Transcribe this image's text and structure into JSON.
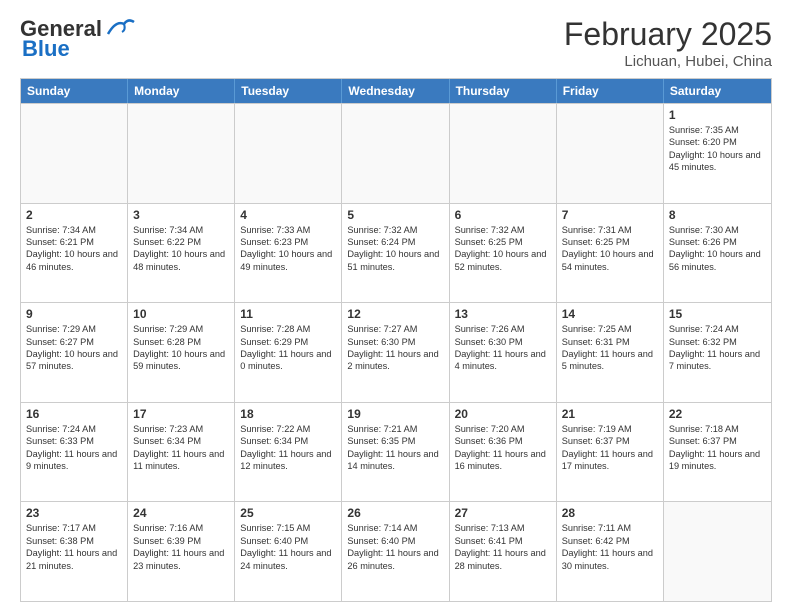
{
  "header": {
    "logo_general": "General",
    "logo_blue": "Blue",
    "month_year": "February 2025",
    "location": "Lichuan, Hubei, China"
  },
  "day_headers": [
    "Sunday",
    "Monday",
    "Tuesday",
    "Wednesday",
    "Thursday",
    "Friday",
    "Saturday"
  ],
  "weeks": [
    {
      "cells": [
        {
          "day": "",
          "info": "",
          "empty": true
        },
        {
          "day": "",
          "info": "",
          "empty": true
        },
        {
          "day": "",
          "info": "",
          "empty": true
        },
        {
          "day": "",
          "info": "",
          "empty": true
        },
        {
          "day": "",
          "info": "",
          "empty": true
        },
        {
          "day": "",
          "info": "",
          "empty": true
        },
        {
          "day": "1",
          "info": "Sunrise: 7:35 AM\nSunset: 6:20 PM\nDaylight: 10 hours and 45 minutes.",
          "empty": false
        }
      ]
    },
    {
      "cells": [
        {
          "day": "2",
          "info": "Sunrise: 7:34 AM\nSunset: 6:21 PM\nDaylight: 10 hours and 46 minutes.",
          "empty": false
        },
        {
          "day": "3",
          "info": "Sunrise: 7:34 AM\nSunset: 6:22 PM\nDaylight: 10 hours and 48 minutes.",
          "empty": false
        },
        {
          "day": "4",
          "info": "Sunrise: 7:33 AM\nSunset: 6:23 PM\nDaylight: 10 hours and 49 minutes.",
          "empty": false
        },
        {
          "day": "5",
          "info": "Sunrise: 7:32 AM\nSunset: 6:24 PM\nDaylight: 10 hours and 51 minutes.",
          "empty": false
        },
        {
          "day": "6",
          "info": "Sunrise: 7:32 AM\nSunset: 6:25 PM\nDaylight: 10 hours and 52 minutes.",
          "empty": false
        },
        {
          "day": "7",
          "info": "Sunrise: 7:31 AM\nSunset: 6:25 PM\nDaylight: 10 hours and 54 minutes.",
          "empty": false
        },
        {
          "day": "8",
          "info": "Sunrise: 7:30 AM\nSunset: 6:26 PM\nDaylight: 10 hours and 56 minutes.",
          "empty": false
        }
      ]
    },
    {
      "cells": [
        {
          "day": "9",
          "info": "Sunrise: 7:29 AM\nSunset: 6:27 PM\nDaylight: 10 hours and 57 minutes.",
          "empty": false
        },
        {
          "day": "10",
          "info": "Sunrise: 7:29 AM\nSunset: 6:28 PM\nDaylight: 10 hours and 59 minutes.",
          "empty": false
        },
        {
          "day": "11",
          "info": "Sunrise: 7:28 AM\nSunset: 6:29 PM\nDaylight: 11 hours and 0 minutes.",
          "empty": false
        },
        {
          "day": "12",
          "info": "Sunrise: 7:27 AM\nSunset: 6:30 PM\nDaylight: 11 hours and 2 minutes.",
          "empty": false
        },
        {
          "day": "13",
          "info": "Sunrise: 7:26 AM\nSunset: 6:30 PM\nDaylight: 11 hours and 4 minutes.",
          "empty": false
        },
        {
          "day": "14",
          "info": "Sunrise: 7:25 AM\nSunset: 6:31 PM\nDaylight: 11 hours and 5 minutes.",
          "empty": false
        },
        {
          "day": "15",
          "info": "Sunrise: 7:24 AM\nSunset: 6:32 PM\nDaylight: 11 hours and 7 minutes.",
          "empty": false
        }
      ]
    },
    {
      "cells": [
        {
          "day": "16",
          "info": "Sunrise: 7:24 AM\nSunset: 6:33 PM\nDaylight: 11 hours and 9 minutes.",
          "empty": false
        },
        {
          "day": "17",
          "info": "Sunrise: 7:23 AM\nSunset: 6:34 PM\nDaylight: 11 hours and 11 minutes.",
          "empty": false
        },
        {
          "day": "18",
          "info": "Sunrise: 7:22 AM\nSunset: 6:34 PM\nDaylight: 11 hours and 12 minutes.",
          "empty": false
        },
        {
          "day": "19",
          "info": "Sunrise: 7:21 AM\nSunset: 6:35 PM\nDaylight: 11 hours and 14 minutes.",
          "empty": false
        },
        {
          "day": "20",
          "info": "Sunrise: 7:20 AM\nSunset: 6:36 PM\nDaylight: 11 hours and 16 minutes.",
          "empty": false
        },
        {
          "day": "21",
          "info": "Sunrise: 7:19 AM\nSunset: 6:37 PM\nDaylight: 11 hours and 17 minutes.",
          "empty": false
        },
        {
          "day": "22",
          "info": "Sunrise: 7:18 AM\nSunset: 6:37 PM\nDaylight: 11 hours and 19 minutes.",
          "empty": false
        }
      ]
    },
    {
      "cells": [
        {
          "day": "23",
          "info": "Sunrise: 7:17 AM\nSunset: 6:38 PM\nDaylight: 11 hours and 21 minutes.",
          "empty": false
        },
        {
          "day": "24",
          "info": "Sunrise: 7:16 AM\nSunset: 6:39 PM\nDaylight: 11 hours and 23 minutes.",
          "empty": false
        },
        {
          "day": "25",
          "info": "Sunrise: 7:15 AM\nSunset: 6:40 PM\nDaylight: 11 hours and 24 minutes.",
          "empty": false
        },
        {
          "day": "26",
          "info": "Sunrise: 7:14 AM\nSunset: 6:40 PM\nDaylight: 11 hours and 26 minutes.",
          "empty": false
        },
        {
          "day": "27",
          "info": "Sunrise: 7:13 AM\nSunset: 6:41 PM\nDaylight: 11 hours and 28 minutes.",
          "empty": false
        },
        {
          "day": "28",
          "info": "Sunrise: 7:11 AM\nSunset: 6:42 PM\nDaylight: 11 hours and 30 minutes.",
          "empty": false
        },
        {
          "day": "",
          "info": "",
          "empty": true
        }
      ]
    }
  ]
}
